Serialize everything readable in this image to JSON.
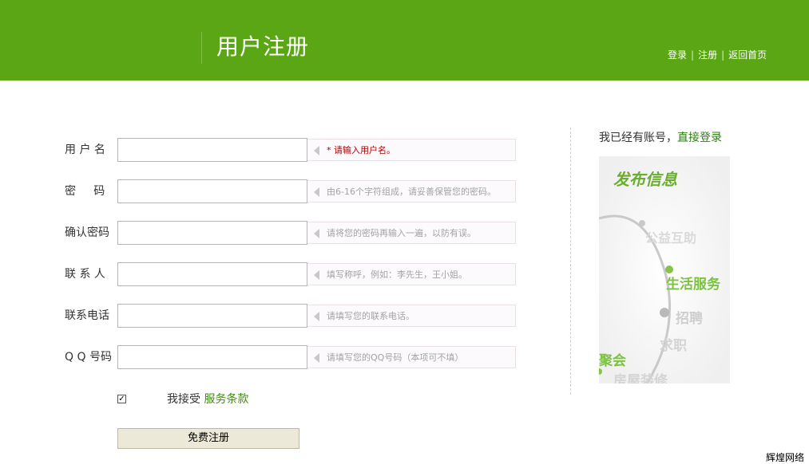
{
  "header": {
    "title": "用户注册",
    "nav": {
      "login": "登录",
      "register": "注册",
      "home": "返回首页",
      "separator": "|"
    }
  },
  "form": {
    "fields": [
      {
        "label": "用 户 名",
        "value": "",
        "hint": "* 请输入用户名。",
        "hint_type": "error"
      },
      {
        "label": "密     码",
        "value": "",
        "hint": "由6-16个字符组成，请妥善保管您的密码。",
        "hint_type": "info"
      },
      {
        "label": "确认密码",
        "value": "",
        "hint": "请将您的密码再输入一遍，以防有误。",
        "hint_type": "info"
      },
      {
        "label": "联 系 人",
        "value": "",
        "hint": "填写称呼，例如：李先生，王小姐。",
        "hint_type": "info"
      },
      {
        "label": "联系电话",
        "value": "",
        "hint": "请填写您的联系电话。",
        "hint_type": "info"
      },
      {
        "label": "Q Q 号码",
        "value": "",
        "hint": "请填写您的QQ号码（本项可不填）",
        "hint_type": "info"
      }
    ],
    "agree": {
      "checked": true,
      "text": "我接受",
      "terms": "服务条款"
    },
    "submit_label": "免费注册"
  },
  "sidebar": {
    "prompt": "我已经有账号，",
    "login_link": "直接登录",
    "promo": {
      "title": "发布信息",
      "items": [
        "公益互助",
        "生活服务",
        "招聘",
        "求职",
        "聚会",
        "房屋装修"
      ]
    }
  },
  "footer": {
    "brand": "辉煌网络"
  },
  "colors": {
    "header_bg": "#5aa614",
    "link_green": "#3f8d0d",
    "error_red": "#b00000"
  }
}
